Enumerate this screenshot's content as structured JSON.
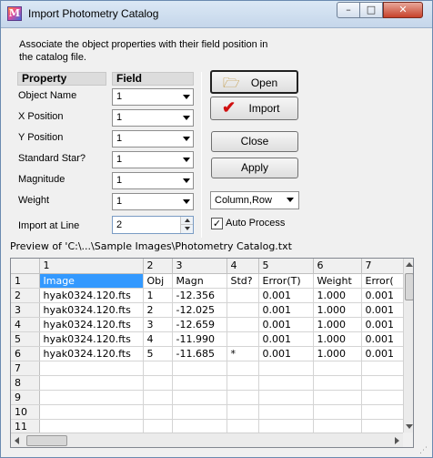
{
  "window": {
    "title": "Import Photometry Catalog",
    "icon_letter": "M",
    "minimize": "–",
    "maximize": "□",
    "close": "✕"
  },
  "description": "Associate the object properties with their field position in the catalog file.",
  "headers": {
    "property": "Property",
    "field": "Field"
  },
  "properties": [
    {
      "label": "Object Name",
      "value": "1"
    },
    {
      "label": "X Position",
      "value": "1"
    },
    {
      "label": "Y Position",
      "value": "1"
    },
    {
      "label": "Standard Star?",
      "value": "1"
    },
    {
      "label": "Magnitude",
      "value": "1"
    },
    {
      "label": "Weight",
      "value": "1"
    }
  ],
  "import_at_line": {
    "label": "Import at Line",
    "value": "2"
  },
  "buttons": {
    "open": "Open",
    "import": "Import",
    "close": "Close",
    "apply": "Apply"
  },
  "order_select": "Column,Row",
  "auto_process": {
    "label": "Auto Process",
    "checked": true
  },
  "preview_label": "Preview of 'C:\\...\\Sample Images\\Photometry Catalog.txt",
  "grid": {
    "col_headers": [
      "",
      "1",
      "2",
      "3",
      "4",
      "5",
      "6",
      "7"
    ],
    "rows": [
      [
        "1",
        "Image",
        "Obj",
        "Magn",
        "Std?",
        "Error(T)",
        "Weight",
        "Error("
      ],
      [
        "2",
        "hyak0324.120.fts",
        "1",
        "-12.356",
        "",
        "0.001",
        "1.000",
        "0.001"
      ],
      [
        "3",
        "hyak0324.120.fts",
        "2",
        "-12.025",
        "",
        "0.001",
        "1.000",
        "0.001"
      ],
      [
        "4",
        "hyak0324.120.fts",
        "3",
        "-12.659",
        "",
        "0.001",
        "1.000",
        "0.001"
      ],
      [
        "5",
        "hyak0324.120.fts",
        "4",
        "-11.990",
        "",
        "0.001",
        "1.000",
        "0.001"
      ],
      [
        "6",
        "hyak0324.120.fts",
        "5",
        "-11.685",
        "*",
        "0.001",
        "1.000",
        "0.001"
      ],
      [
        "7",
        "",
        "",
        "",
        "",
        "",
        "",
        ""
      ],
      [
        "8",
        "",
        "",
        "",
        "",
        "",
        "",
        ""
      ],
      [
        "9",
        "",
        "",
        "",
        "",
        "",
        "",
        ""
      ],
      [
        "10",
        "",
        "",
        "",
        "",
        "",
        "",
        ""
      ],
      [
        "11",
        "",
        "",
        "",
        "",
        "",
        "",
        ""
      ]
    ]
  },
  "colors": {
    "selection": "#3399ff",
    "title_bar": "#dbe8f5",
    "close_button": "#c7412a"
  }
}
